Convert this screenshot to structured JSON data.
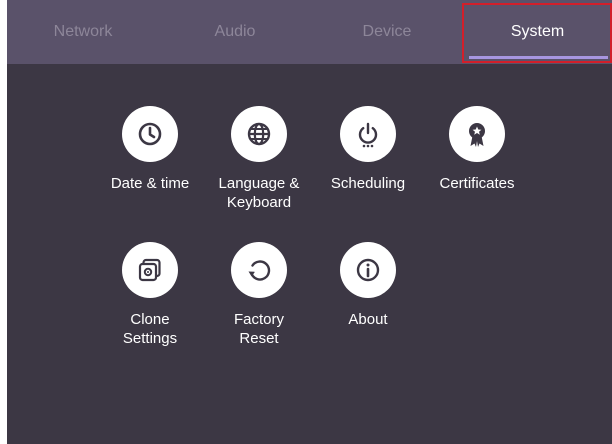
{
  "tabs": [
    {
      "label": "Network",
      "active": false
    },
    {
      "label": "Audio",
      "active": false
    },
    {
      "label": "Device",
      "active": false
    },
    {
      "label": "System",
      "active": true
    }
  ],
  "items": [
    {
      "label": "Date & time",
      "icon": "clock-icon"
    },
    {
      "label": "Language &\nKeyboard",
      "icon": "globe-icon"
    },
    {
      "label": "Scheduling",
      "icon": "power-schedule-icon"
    },
    {
      "label": "Certificates",
      "icon": "certificate-icon"
    },
    {
      "label": "Clone\nSettings",
      "icon": "clone-settings-icon"
    },
    {
      "label": "Factory\nReset",
      "icon": "reset-icon"
    },
    {
      "label": "About",
      "icon": "info-icon"
    }
  ],
  "colors": {
    "background": "#3c3744",
    "tab_bar": "#5a526a",
    "tab_inactive_text": "#8d8699",
    "tab_active_text": "#ffffff",
    "tab_underline": "#a796e0",
    "highlight_box": "#d21f2a",
    "icon_circle": "#ffffff",
    "icon_glyph": "#3c3744"
  }
}
